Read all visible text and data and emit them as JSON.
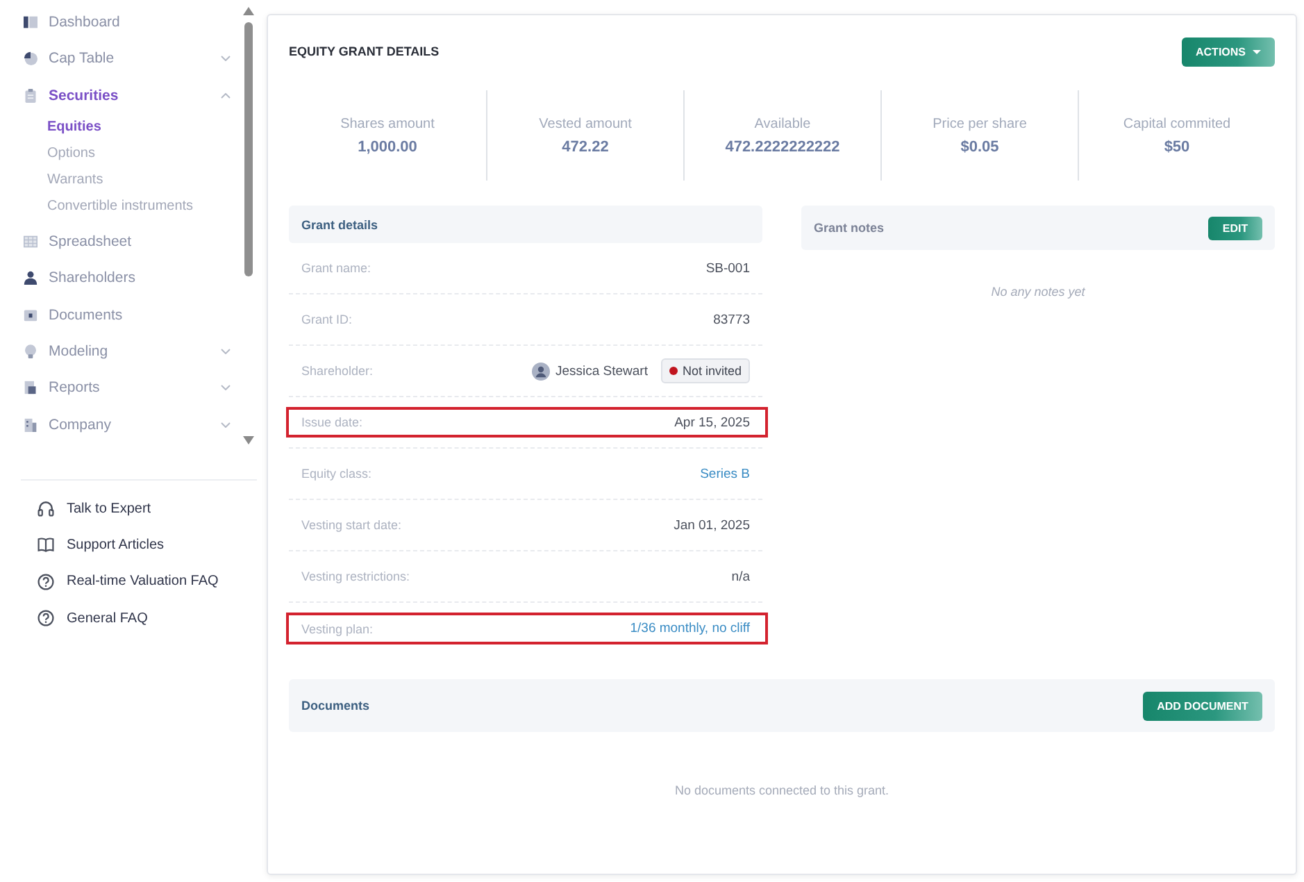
{
  "sidebar": {
    "nav_items": [
      {
        "label": "Dashboard",
        "kind": "link",
        "selected": false
      },
      {
        "label": "Cap Table",
        "kind": "group",
        "selected": false,
        "expanded": false
      },
      {
        "label": "Securities",
        "kind": "group",
        "selected": true,
        "expanded": true,
        "children": [
          {
            "label": "Equities",
            "selected": true
          },
          {
            "label": "Options",
            "selected": false
          },
          {
            "label": "Warrants",
            "selected": false
          },
          {
            "label": "Convertible instruments",
            "selected": false
          }
        ]
      },
      {
        "label": "Spreadsheet",
        "kind": "link",
        "selected": false
      },
      {
        "label": "Shareholders",
        "kind": "link",
        "selected": false
      },
      {
        "label": "Documents",
        "kind": "link",
        "selected": false
      },
      {
        "label": "Modeling",
        "kind": "group",
        "selected": false,
        "expanded": false
      },
      {
        "label": "Reports",
        "kind": "group",
        "selected": false,
        "expanded": false
      },
      {
        "label": "Company",
        "kind": "group",
        "selected": false,
        "expanded": false
      }
    ],
    "help_links": [
      {
        "label": "Talk to Expert"
      },
      {
        "label": "Support Articles"
      },
      {
        "label": "Real-time Valuation FAQ"
      },
      {
        "label": "General FAQ"
      }
    ]
  },
  "grant": {
    "title": "EQUITY GRANT DETAILS",
    "actions_button": "ACTIONS",
    "stats": [
      {
        "label": "Shares amount",
        "value": "1,000.00"
      },
      {
        "label": "Vested amount",
        "value": "472.22"
      },
      {
        "label": "Available",
        "value": "472.2222222222"
      },
      {
        "label": "Price per share",
        "value": "$0.05"
      },
      {
        "label": "Capital commited",
        "value": "$50"
      }
    ],
    "details": {
      "title": "Grant details",
      "rows": [
        {
          "label": "Grant name:",
          "kind": "text",
          "value": "SB-001",
          "highlighted": false
        },
        {
          "label": "Grant ID:",
          "kind": "text",
          "value": "83773",
          "highlighted": false
        },
        {
          "label": "Shareholder:",
          "kind": "person",
          "value": "Jessica Stewart",
          "badge": "Not invited",
          "highlighted": false
        },
        {
          "label": "Issue date:",
          "kind": "text",
          "value": "Apr 15, 2025",
          "highlighted": true
        },
        {
          "label": "Equity class:",
          "kind": "link",
          "value": "Series B",
          "highlighted": false
        },
        {
          "label": "Vesting start date:",
          "kind": "text",
          "value": "Jan 01, 2025",
          "highlighted": false
        },
        {
          "label": "Vesting restrictions:",
          "kind": "text",
          "value": "n/a",
          "highlighted": false
        },
        {
          "label": "Vesting plan:",
          "kind": "link",
          "value": "1/36 monthly, no cliff",
          "highlighted": true
        }
      ]
    },
    "notes": {
      "title": "Grant notes",
      "edit_button": "EDIT",
      "empty_text": "No any notes yet"
    },
    "documents": {
      "title": "Documents",
      "add_button": "ADD DOCUMENT",
      "empty_text": "No documents connected to this grant."
    }
  }
}
